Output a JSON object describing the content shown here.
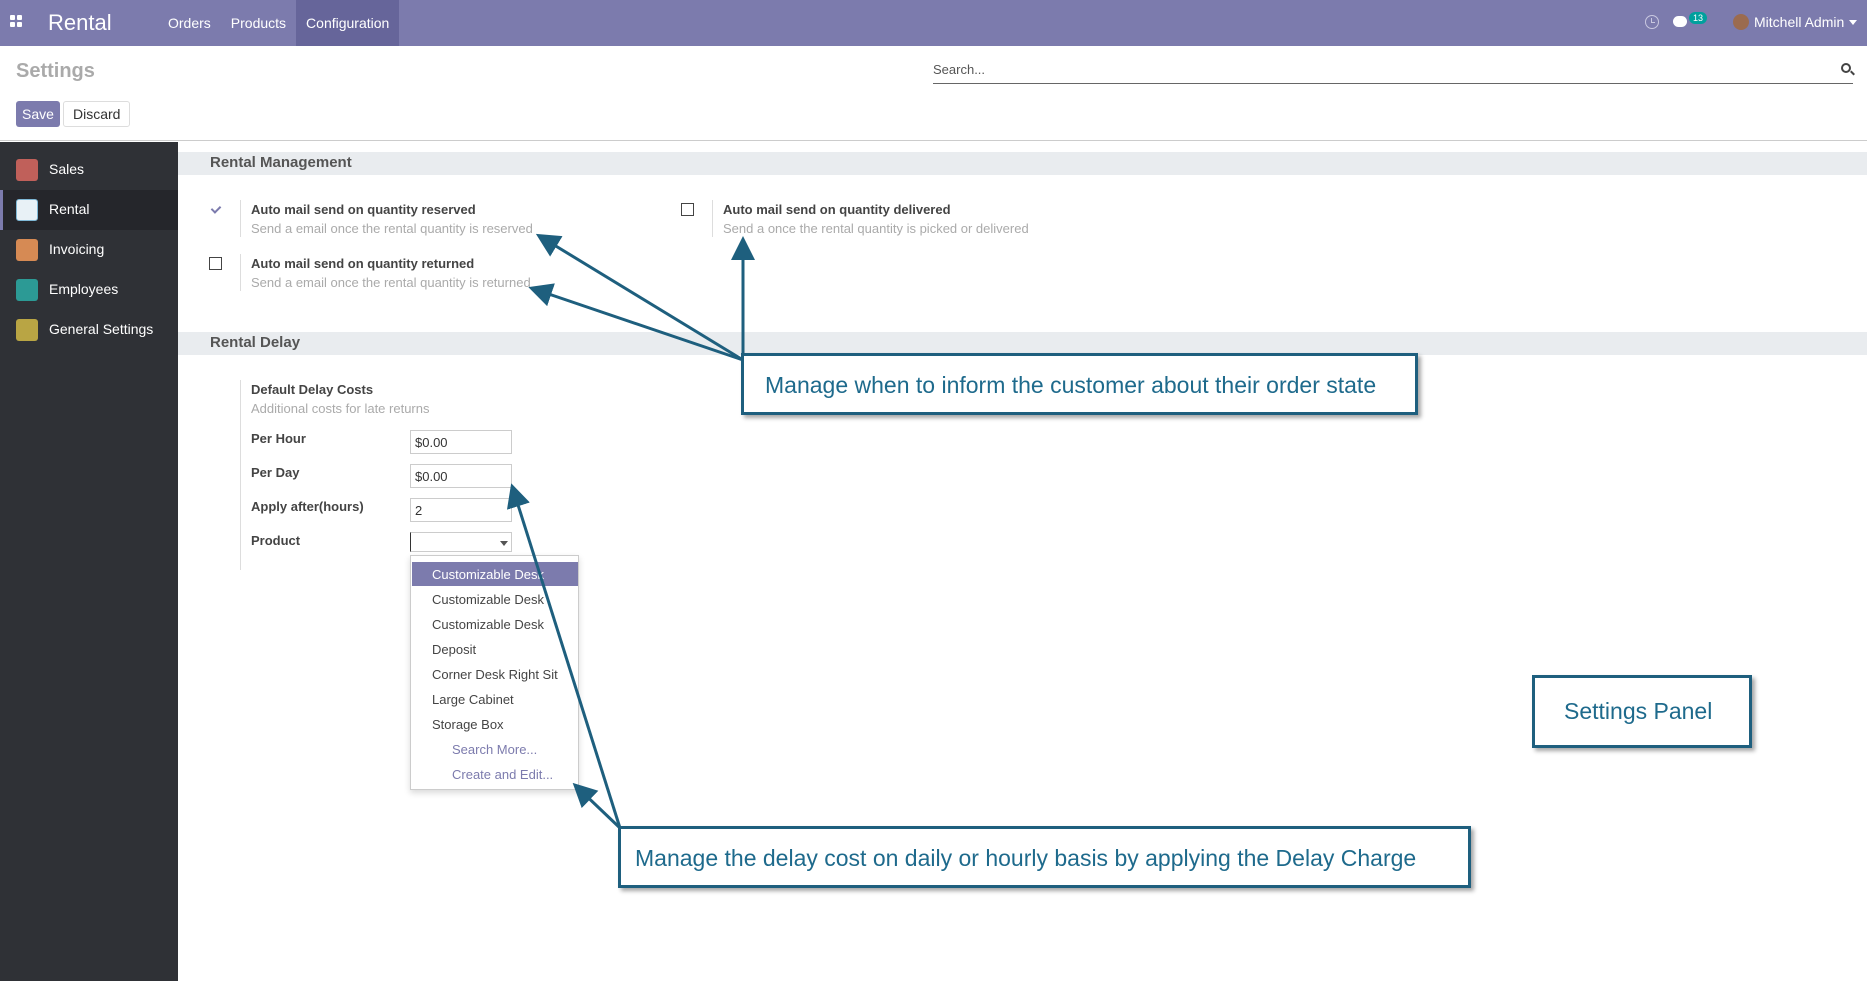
{
  "navbar": {
    "app_title": "Rental",
    "menu": [
      "Orders",
      "Products",
      "Configuration"
    ],
    "notification_count": "13",
    "user_name": "Mitchell Admin"
  },
  "control_panel": {
    "title": "Settings",
    "search_placeholder": "Search...",
    "save_label": "Save",
    "discard_label": "Discard"
  },
  "sidebar": {
    "items": [
      {
        "label": "Sales",
        "icon": "sales-icon",
        "color": "#c0605a"
      },
      {
        "label": "Rental",
        "icon": "rental-icon",
        "color": "#e8f1f6"
      },
      {
        "label": "Invoicing",
        "icon": "invoicing-icon",
        "color": "#d68a54"
      },
      {
        "label": "Employees",
        "icon": "employees-icon",
        "color": "#2c9a95"
      },
      {
        "label": "General Settings",
        "icon": "gear-icon",
        "color": "#b9a544"
      }
    ]
  },
  "rental_management": {
    "heading": "Rental Management",
    "reserved": {
      "title": "Auto mail send on quantity reserved",
      "desc": "Send a email once the rental quantity is reserved",
      "checked": true
    },
    "delivered": {
      "title": "Auto mail send on quantity delivered",
      "desc": "Send a once the rental quantity is picked or delivered",
      "checked": false
    },
    "returned": {
      "title": "Auto mail send on quantity returned",
      "desc": "Send a email once the rental quantity is returned",
      "checked": false
    }
  },
  "rental_delay": {
    "heading": "Rental Delay",
    "title": "Default Delay Costs",
    "desc": "Additional costs for late returns",
    "per_hour_label": "Per Hour",
    "per_hour_value": "$0.00",
    "per_day_label": "Per Day",
    "per_day_value": "$0.00",
    "apply_after_label": "Apply after(hours)",
    "apply_after_value": "2",
    "product_label": "Product",
    "product_value": ""
  },
  "product_dropdown": {
    "options": [
      "Customizable Desk",
      "Customizable Desk",
      "Customizable Desk",
      "Deposit",
      "Corner Desk Right Sit",
      "Large Cabinet",
      "Storage Box"
    ],
    "search_more": "Search More...",
    "create_edit": "Create and Edit..."
  },
  "annotations": {
    "notify": "Manage when to inform the customer about their order state",
    "settings_panel": "Settings Panel",
    "delay": "Manage the delay cost on daily or hourly basis by applying the Delay Charge"
  }
}
